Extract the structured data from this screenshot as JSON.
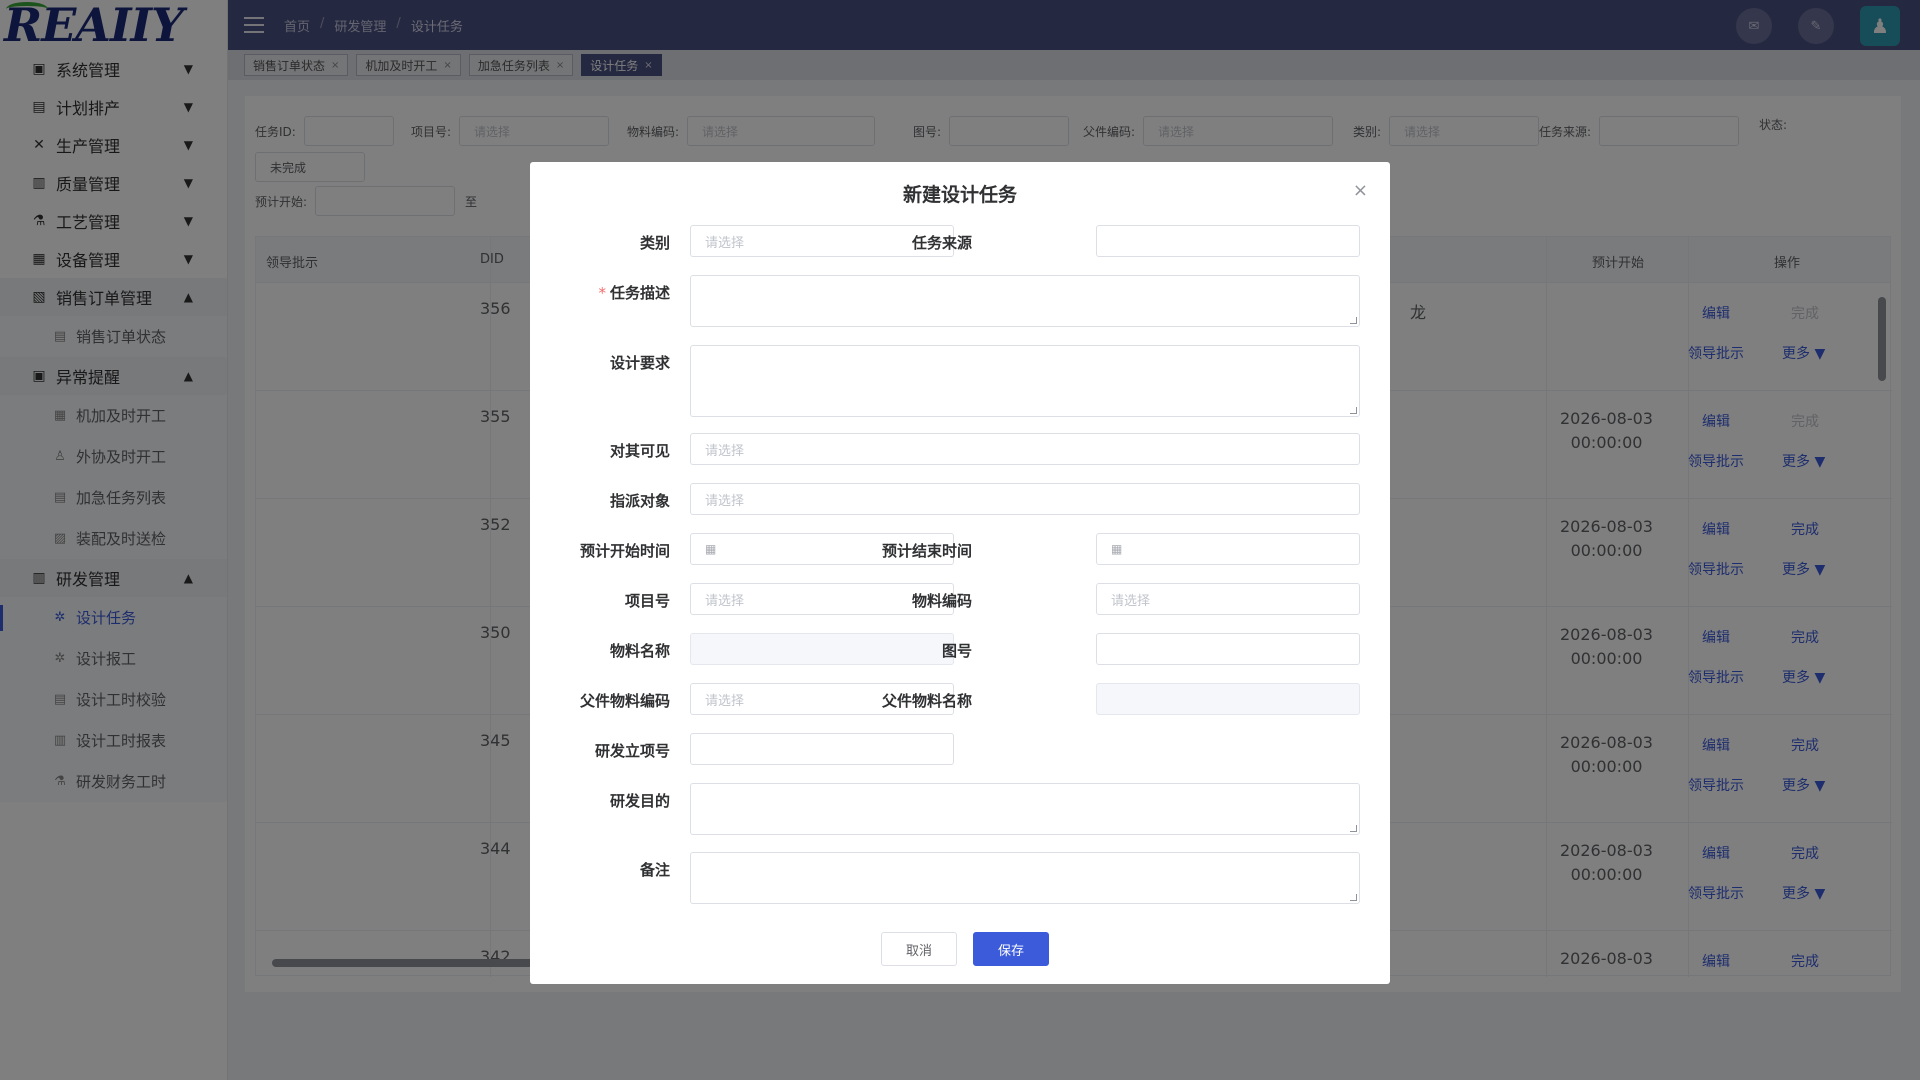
{
  "logo": {
    "text": "REAIIY"
  },
  "sidebar": {
    "items": [
      {
        "label": "系统管理",
        "icon": "monitor-icon",
        "arrow": "▼"
      },
      {
        "label": "计划排产",
        "icon": "document-icon",
        "arrow": "▼"
      },
      {
        "label": "生产管理",
        "icon": "tools-icon",
        "arrow": "▼"
      },
      {
        "label": "质量管理",
        "icon": "clipboard-icon",
        "arrow": "▼"
      },
      {
        "label": "工艺管理",
        "icon": "flask-icon",
        "arrow": "▼"
      },
      {
        "label": "设备管理",
        "icon": "machine-icon",
        "arrow": "▼"
      },
      {
        "label": "销售订单管理",
        "icon": "ledger-icon",
        "arrow": "▲"
      },
      {
        "label": "异常提醒",
        "icon": "alert-monitor-icon",
        "arrow": "▲"
      },
      {
        "label": "研发管理",
        "icon": "calendar-icon",
        "arrow": "▲"
      }
    ],
    "sales_sub": [
      {
        "label": "销售订单状态"
      }
    ],
    "alert_sub": [
      {
        "label": "机加及时开工"
      },
      {
        "label": "外协及时开工"
      },
      {
        "label": "加急任务列表"
      },
      {
        "label": "装配及时送检"
      }
    ],
    "rd_sub": [
      {
        "label": "设计任务"
      },
      {
        "label": "设计报工"
      },
      {
        "label": "设计工时校验"
      },
      {
        "label": "设计工时报表"
      },
      {
        "label": "研发财务工时"
      }
    ]
  },
  "header": {
    "breadcrumb": [
      "首页",
      "研发管理",
      "设计任务"
    ],
    "separator": "/"
  },
  "tags": [
    {
      "label": "销售订单状态",
      "close": "×"
    },
    {
      "label": "机加及时开工",
      "close": "×"
    },
    {
      "label": "加急任务列表",
      "close": "×"
    },
    {
      "label": "设计任务",
      "close": "×"
    }
  ],
  "filters": {
    "task_id": "任务ID:",
    "project": "项目号:",
    "project_ph": "请选择",
    "material": "物料编码:",
    "material_ph": "请选择",
    "drawing": "图号:",
    "parent": "父件编码:",
    "parent_ph": "请选择",
    "category": "类别:",
    "category_ph": "请选择",
    "source": "任务来源:",
    "status": "状态:",
    "status_value": "未完成",
    "plan_start": "预计开始:",
    "to": "至"
  },
  "grid": {
    "headers": {
      "leader": "领导批示",
      "did": "DID",
      "plan_start": "预计开始",
      "ops": "操作"
    },
    "rows": [
      {
        "did": "356",
        "date": "",
        "time": "",
        "op_done": "完成",
        "done_dim": true,
        "extra": "龙"
      },
      {
        "did": "355",
        "date": "2026-08-03",
        "time": "00:00:00",
        "op_done": "完成",
        "done_dim": true,
        "extra": ""
      },
      {
        "did": "352",
        "date": "2026-08-03",
        "time": "00:00:00",
        "op_done": "完成",
        "done_dim": false,
        "extra": ""
      },
      {
        "did": "350",
        "date": "2026-08-03",
        "time": "00:00:00",
        "op_done": "完成",
        "done_dim": false,
        "extra": ""
      },
      {
        "did": "345",
        "date": "2026-08-03",
        "time": "00:00:00",
        "op_done": "完成",
        "done_dim": false,
        "extra": ""
      },
      {
        "did": "344",
        "date": "2026-08-03",
        "time": "00:00:00",
        "op_done": "完成",
        "done_dim": false,
        "extra": ""
      },
      {
        "did": "342",
        "date": "2026-08-03",
        "time": "",
        "op_done": "完成",
        "done_dim": false,
        "extra": ""
      }
    ],
    "op_edit": "编辑",
    "op_leader": "领导批示",
    "op_more": "更多 ▼"
  },
  "dialog": {
    "title": "新建设计任务",
    "close": "×",
    "labels": {
      "category": "类别",
      "source": "任务来源",
      "desc_req": "*",
      "desc": "任务描述",
      "requirement": "设计要求",
      "visible": "对其可见",
      "assign": "指派对象",
      "plan_start": "预计开始时间",
      "plan_end": "预计结束时间",
      "project": "项目号",
      "material_code": "物料编码",
      "material_name": "物料名称",
      "drawing": "图号",
      "parent_code": "父件物料编码",
      "parent_name": "父件物料名称",
      "rd_project": "研发立项号",
      "rd_purpose": "研发目的",
      "remark": "备注"
    },
    "placeholders": {
      "select": "请选择"
    },
    "buttons": {
      "cancel": "取消",
      "save": "保存"
    }
  }
}
